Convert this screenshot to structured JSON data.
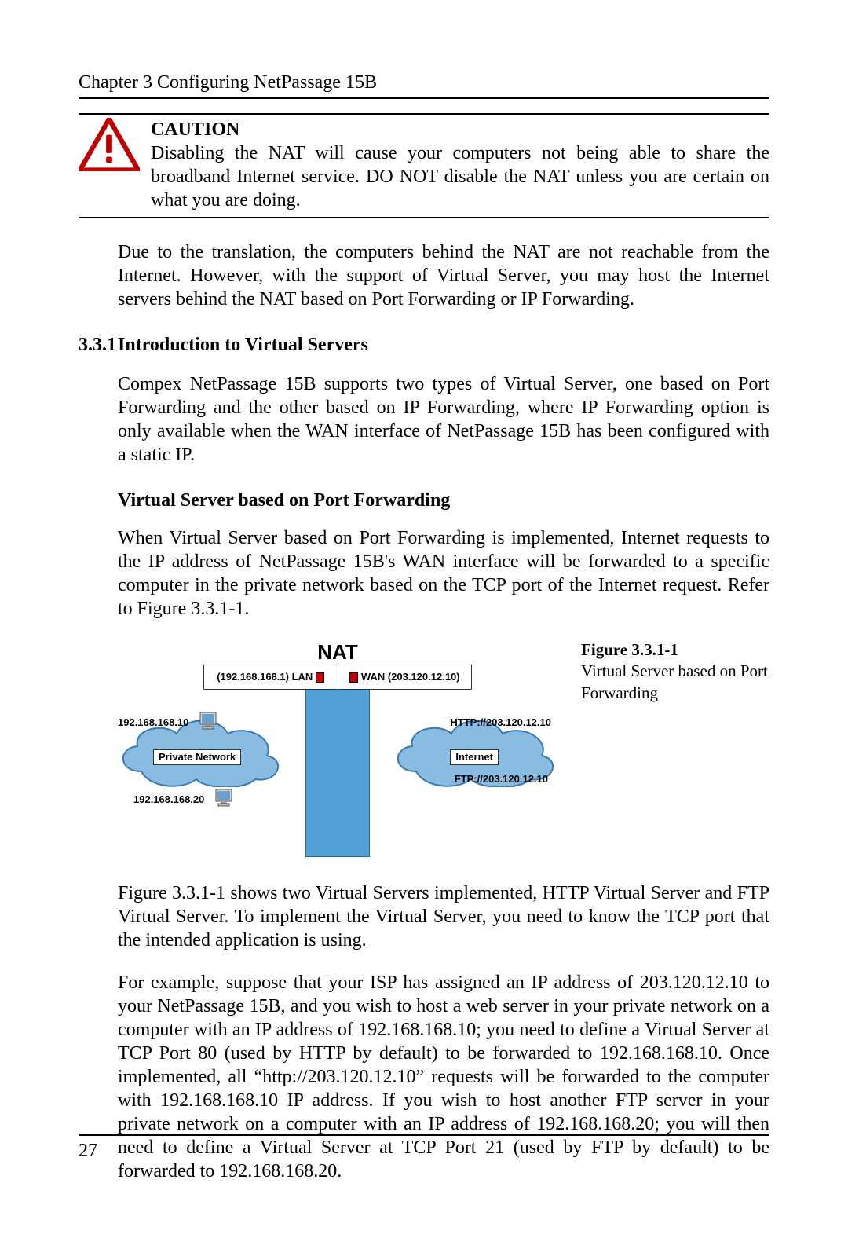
{
  "chapter_header": "Chapter 3 Configuring NetPassage 15B",
  "caution": {
    "title": "CAUTION",
    "text": "Disabling the NAT will cause your computers not being able to share the broadband Internet service. DO NOT disable the NAT unless you are certain on what you are doing."
  },
  "para_intro": "Due to the translation, the computers behind the NAT are not reachable from the Internet. However, with the support of Virtual Server, you may host the Internet servers behind the NAT based on Port Forwarding or IP Forwarding.",
  "section": {
    "number": "3.3.1",
    "title": "Introduction to Virtual Servers"
  },
  "para_331a": "Compex NetPassage 15B supports two types of Virtual Server, one based on Port Forwarding and the other based on IP Forwarding, where IP Forwarding option is only available when the WAN interface of NetPassage 15B has been configured with a static IP.",
  "sub_heading_pf": "Virtual Server based on Port Forwarding",
  "para_pf": "When Virtual Server based on Port Forwarding is implemented, Internet requests to the IP address of NetPassage 15B's WAN interface will be forwarded to a specific computer in the private network based on the TCP port of the Internet request. Refer to Figure 3.3.1-1.",
  "diagram": {
    "nat_title": "NAT",
    "lan_label": "(192.168.168.1) LAN",
    "wan_label": "WAN (203.120.12.10)",
    "private_net_label": "Private Network",
    "internet_label": "Internet",
    "http_label": "HTTP://203.120.12.10",
    "ftp_label": "FTP://203.120.12.10",
    "ip1": "192.168.168.10",
    "ip2": "192.168.168.20"
  },
  "figure_caption": {
    "number": "Figure 3.3.1-1",
    "text": "Virtual Server based on Port Forwarding"
  },
  "para_after_fig": "Figure 3.3.1-1 shows two Virtual Servers implemented, HTTP Virtual Server and FTP Virtual Server. To implement the Virtual Server, you need to know the TCP port that the intended application is using.",
  "para_example": "For example, suppose that your ISP has assigned an IP address of 203.120.12.10 to your NetPassage 15B, and you wish to host a web server in your private network on a computer with an IP address of 192.168.168.10; you need to define a Virtual Server at TCP Port 80 (used by HTTP by default) to be forwarded to 192.168.168.10. Once implemented, all “http://203.120.12.10” requests will be forwarded to the computer with 192.168.168.10 IP address. If you wish to host another FTP server in your private network on a computer with an IP address of 192.168.168.20; you will then need to define a Virtual Server at TCP Port 21 (used by FTP by default) to be forwarded to 192.168.168.20.",
  "page_number": "27"
}
